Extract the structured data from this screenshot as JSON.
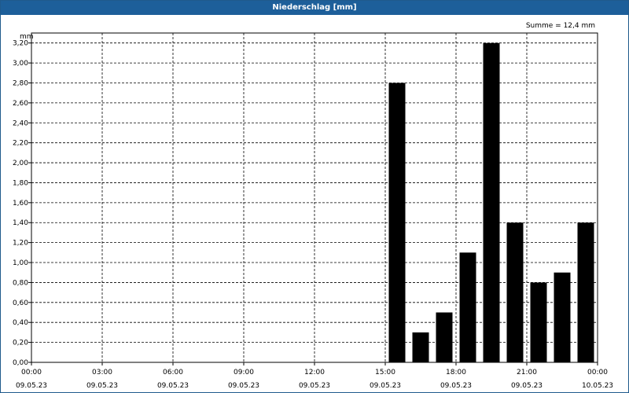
{
  "window": {
    "title": "Niederschlag [mm]"
  },
  "chart_data": {
    "type": "bar",
    "title": "Niederschlag [mm]",
    "annotation": "Summe = 12,4 mm",
    "ylabel": "mm",
    "ylim": [
      0,
      3.3
    ],
    "grid": true,
    "y_ticks": [
      "0,00",
      "0,20",
      "0,40",
      "0,60",
      "0,80",
      "1,00",
      "1,20",
      "1,40",
      "1,60",
      "1,80",
      "2,00",
      "2,20",
      "2,40",
      "2,60",
      "2,80",
      "3,00",
      "3,20"
    ],
    "x_ticks": [
      {
        "time": "00:00",
        "date": "09.05.23"
      },
      {
        "time": "03:00",
        "date": "09.05.23"
      },
      {
        "time": "06:00",
        "date": "09.05.23"
      },
      {
        "time": "09:00",
        "date": "09.05.23"
      },
      {
        "time": "12:00",
        "date": "09.05.23"
      },
      {
        "time": "15:00",
        "date": "09.05.23"
      },
      {
        "time": "18:00",
        "date": "09.05.23"
      },
      {
        "time": "21:00",
        "date": "09.05.23"
      },
      {
        "time": "00:00",
        "date": "10.05.23"
      }
    ],
    "bar_color": "#000000",
    "bars": [
      {
        "time": "15:00",
        "value": 2.8
      },
      {
        "time": "16:00",
        "value": 0.3
      },
      {
        "time": "17:00",
        "value": 0.5
      },
      {
        "time": "18:00",
        "value": 1.1
      },
      {
        "time": "19:00",
        "value": 3.2
      },
      {
        "time": "20:00",
        "value": 1.4
      },
      {
        "time": "21:00",
        "value": 0.8
      },
      {
        "time": "22:00",
        "value": 0.9
      },
      {
        "time": "23:00",
        "value": 1.4
      }
    ]
  }
}
